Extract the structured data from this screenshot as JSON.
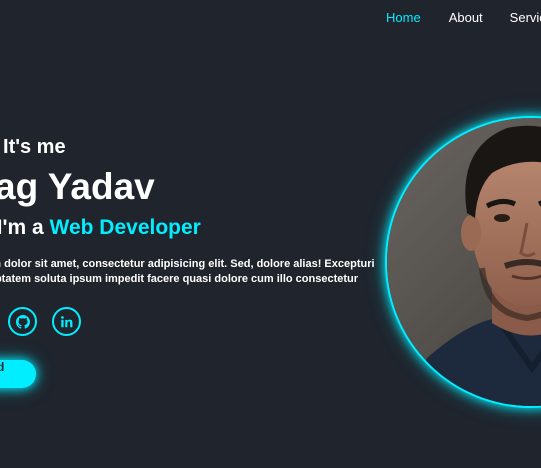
{
  "nav": {
    "items": [
      {
        "label": "Home",
        "active": true
      },
      {
        "label": "About",
        "active": false
      },
      {
        "label": "Services",
        "active": false
      }
    ]
  },
  "hero": {
    "greeting": "Hello, It's me",
    "name": "Chirag Yadav",
    "role_prefix": "And I'm a",
    "role": "Web Developer",
    "description_line_1": "Lorem ipsum dolor sit amet, consectetur adipisicing elit. Sed, dolore alias! Excepturi",
    "description_line_2": "tenetur voluptatem soluta ipsum impedit facere quasi dolore cum illo consectetur"
  },
  "social": [
    {
      "name": "github-icon"
    },
    {
      "name": "linkedin-icon"
    }
  ],
  "cta": {
    "label": "Download CV"
  },
  "colors": {
    "background": "#1f242d",
    "accent": "#00eeff",
    "text": "#ffffff"
  }
}
